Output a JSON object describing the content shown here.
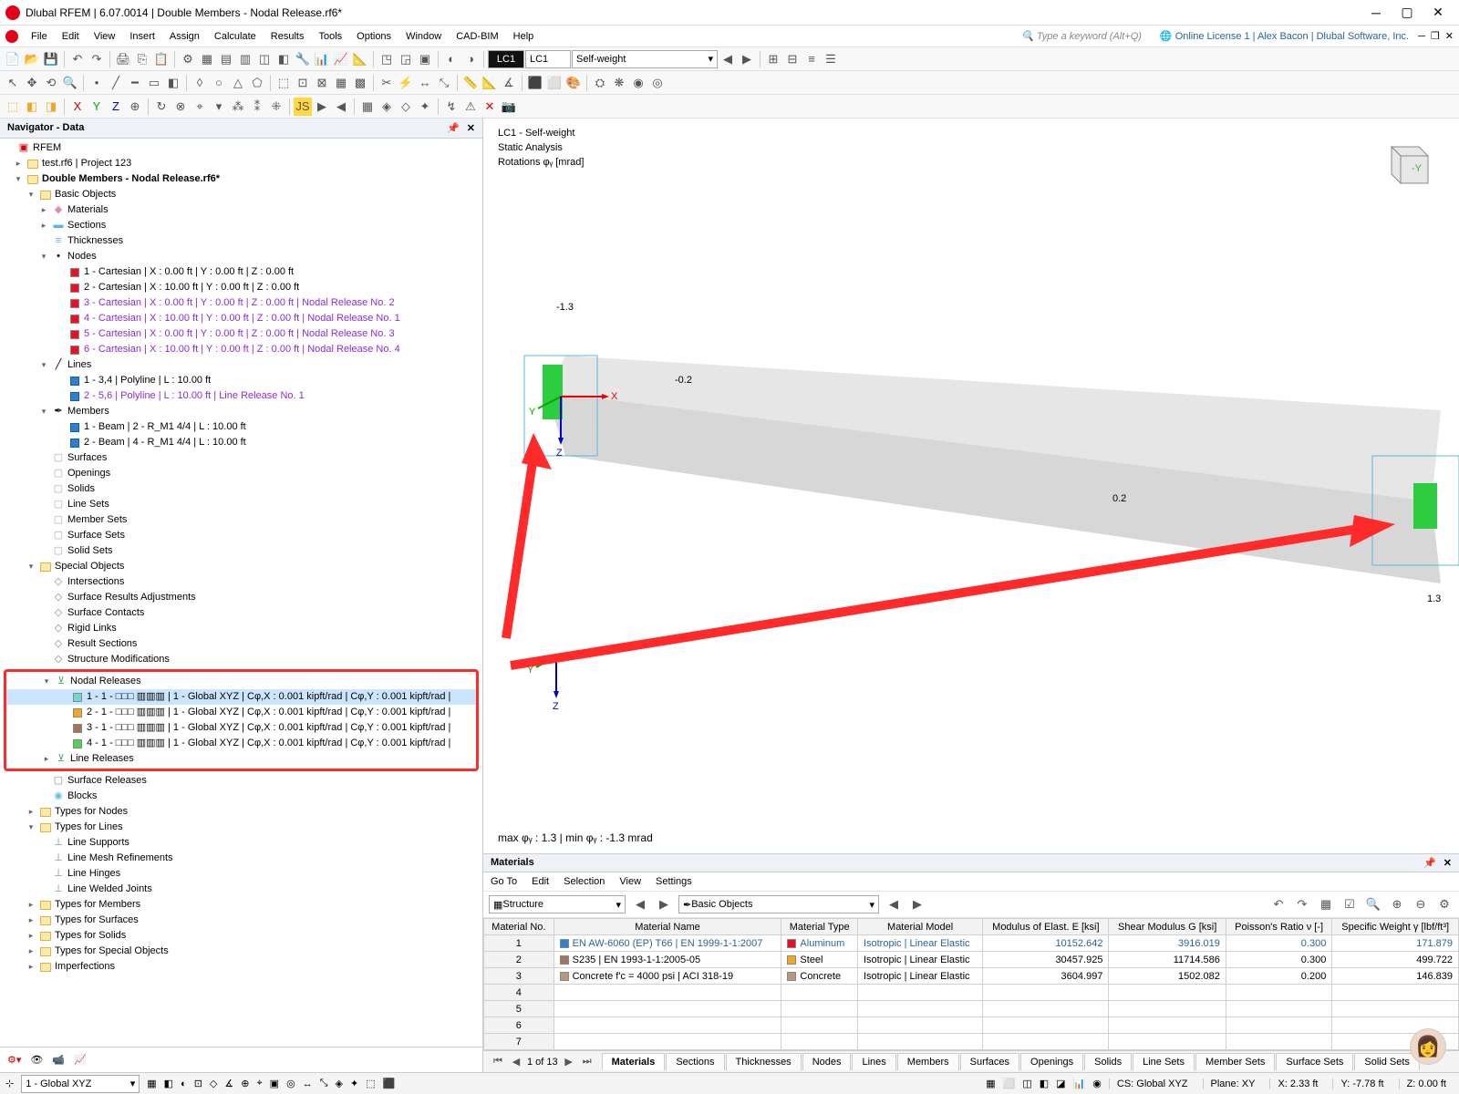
{
  "title": "Dlubal RFEM | 6.07.0014 | Double Members - Nodal Release.rf6*",
  "menu": [
    "File",
    "Edit",
    "View",
    "Insert",
    "Assign",
    "Calculate",
    "Results",
    "Tools",
    "Options",
    "Window",
    "CAD-BIM",
    "Help"
  ],
  "keyword_hint": "Type a keyword (Alt+Q)",
  "license": "Online License 1 | Alex Bacon | Dlubal Software, Inc.",
  "lc_badge": "LC1",
  "lc_select": "Self-weight",
  "nav_title": "Navigator - Data",
  "tree": {
    "root": "RFEM",
    "proj1": "test.rf6 | Project 123",
    "proj2": "Double Members - Nodal Release.rf6*",
    "basic": "Basic Objects",
    "materials": "Materials",
    "sections": "Sections",
    "thick": "Thicknesses",
    "nodes_h": "Nodes",
    "nodes": [
      "1 - Cartesian | X : 0.00 ft | Y : 0.00 ft | Z : 0.00 ft",
      "2 - Cartesian | X : 10.00 ft | Y : 0.00 ft | Z : 0.00 ft",
      "3 - Cartesian | X : 0.00 ft | Y : 0.00 ft | Z : 0.00 ft | Nodal Release No. 2",
      "4 - Cartesian | X : 10.00 ft | Y : 0.00 ft | Z : 0.00 ft | Nodal Release No. 1",
      "5 - Cartesian | X : 0.00 ft | Y : 0.00 ft | Z : 0.00 ft | Nodal Release No. 3",
      "6 - Cartesian | X : 10.00 ft | Y : 0.00 ft | Z : 0.00 ft | Nodal Release No. 4"
    ],
    "lines_h": "Lines",
    "lines": [
      "1 - 3,4 | Polyline | L : 10.00 ft",
      "2 - 5,6 | Polyline | L : 10.00 ft | Line Release No. 1"
    ],
    "members_h": "Members",
    "members": [
      "1 - Beam | 2 - R_M1 4/4 | L : 10.00 ft",
      "2 - Beam | 4 - R_M1 4/4 | L : 10.00 ft"
    ],
    "leaf": [
      "Surfaces",
      "Openings",
      "Solids",
      "Line Sets",
      "Member Sets",
      "Surface Sets",
      "Solid Sets"
    ],
    "special": "Special Objects",
    "special_items": [
      "Intersections",
      "Surface Results Adjustments",
      "Surface Contacts",
      "Rigid Links",
      "Result Sections",
      "Structure Modifications"
    ],
    "nodal_rel": "Nodal Releases",
    "releases": [
      "1 - 1 - □□□ ▥▥▥ | 1 - Global XYZ | Cφ,X : 0.001 kipft/rad | Cφ,Y : 0.001 kipft/rad |",
      "2 - 1 - □□□ ▥▥▥ | 1 - Global XYZ | Cφ,X : 0.001 kipft/rad | Cφ,Y : 0.001 kipft/rad |",
      "3 - 1 - □□□ ▥▥▥ | 1 - Global XYZ | Cφ,X : 0.001 kipft/rad | Cφ,Y : 0.001 kipft/rad |",
      "4 - 1 - □□□ ▥▥▥ | 1 - Global XYZ | Cφ,X : 0.001 kipft/rad | Cφ,Y : 0.001 kipft/rad |"
    ],
    "line_rel": "Line Releases",
    "surf_rel": "Surface Releases",
    "blocks": "Blocks",
    "types": [
      "Types for Nodes",
      "Types for Lines"
    ],
    "tline_items": [
      "Line Supports",
      "Line Mesh Refinements",
      "Line Hinges",
      "Line Welded Joints"
    ],
    "types2": [
      "Types for Members",
      "Types for Surfaces",
      "Types for Solids",
      "Types for Special Objects",
      "Imperfections"
    ]
  },
  "view": {
    "l1": "LC1 - Self-weight",
    "l2": "Static Analysis",
    "l3": "Rotations φᵧ [mrad]",
    "minmax": "max φᵧ : 1.3 | min φᵧ : -1.3 mrad",
    "v1": "-1.3",
    "v2": "-0.2",
    "v3": "0.2",
    "v4": "1.3"
  },
  "materials": {
    "title": "Materials",
    "menu": [
      "Go To",
      "Edit",
      "Selection",
      "View",
      "Settings"
    ],
    "struct": "Structure",
    "basic": "Basic Objects",
    "cols": [
      "Material No.",
      "Material Name",
      "Material Type",
      "Material Model",
      "Modulus of Elast. E [ksi]",
      "Shear Modulus G [ksi]",
      "Poisson's Ratio ν [-]",
      "Specific Weight γ [lbf/ft³]"
    ],
    "rows": [
      {
        "no": "1",
        "name": "EN AW-6060 (EP) T66 | EN 1999-1-1:2007",
        "type": "Aluminum",
        "model": "Isotropic | Linear Elastic",
        "E": "10152.642",
        "G": "3916.019",
        "nu": "0.300",
        "w": "171.879",
        "c": "#2f7fd1",
        "link": true
      },
      {
        "no": "2",
        "name": "S235 | EN 1993-1-1:2005-05",
        "type": "Steel",
        "model": "Isotropic | Linear Elastic",
        "E": "30457.925",
        "G": "11714.586",
        "nu": "0.300",
        "w": "499.722",
        "c": "#a0755a"
      },
      {
        "no": "3",
        "name": "Concrete f'c = 4000 psi | ACI 318-19",
        "type": "Concrete",
        "model": "Isotropic | Linear Elastic",
        "E": "3604.997",
        "G": "1502.082",
        "nu": "0.200",
        "w": "146.839",
        "c": "#b89a7a"
      }
    ],
    "empty": [
      "4",
      "5",
      "6",
      "7"
    ],
    "pager": "1 of 13",
    "tabs": [
      "Materials",
      "Sections",
      "Thicknesses",
      "Nodes",
      "Lines",
      "Members",
      "Surfaces",
      "Openings",
      "Solids",
      "Line Sets",
      "Member Sets",
      "Surface Sets",
      "Solid Sets"
    ]
  },
  "status": {
    "cs": "1 - Global XYZ",
    "csl": "CS: Global XYZ",
    "plane": "Plane: XY",
    "x": "X: 2.33 ft",
    "y": "Y: -7.78 ft",
    "z": "Z: 0.00 ft"
  }
}
